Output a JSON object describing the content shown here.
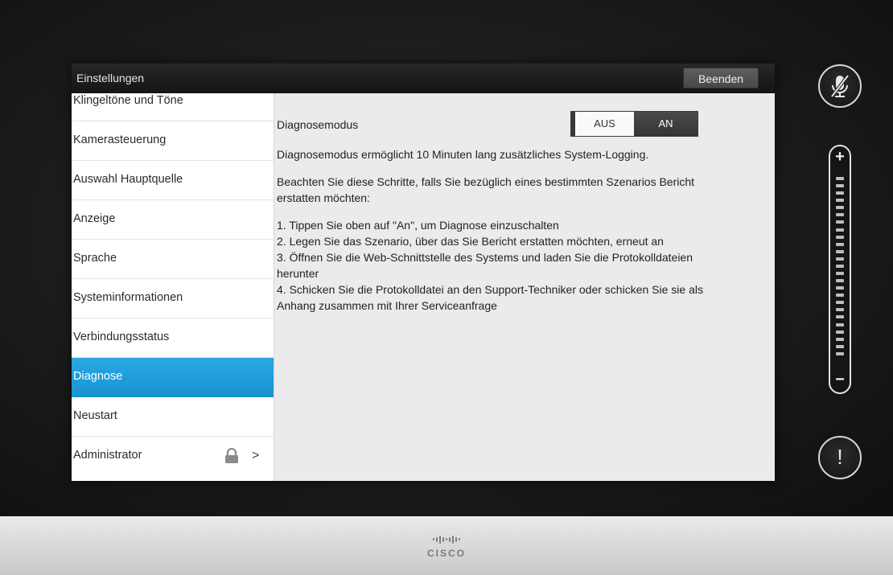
{
  "window": {
    "title": "Einstellungen",
    "end_label": "Beenden"
  },
  "sidebar": {
    "items": [
      {
        "label": "Klingeltöne und Töne"
      },
      {
        "label": "Kamerasteuerung"
      },
      {
        "label": "Auswahl Hauptquelle"
      },
      {
        "label": "Anzeige"
      },
      {
        "label": "Sprache"
      },
      {
        "label": "Systeminformationen"
      },
      {
        "label": "Verbindungsstatus"
      },
      {
        "label": "Diagnose",
        "selected": true
      },
      {
        "label": "Neustart"
      },
      {
        "label": "Administrator",
        "locked": true,
        "icon": "lock-icon",
        "trailing_icon": "chevron-right-icon"
      }
    ]
  },
  "content": {
    "diagnose_label": "Diagnosemodus",
    "toggle": {
      "off_label": "AUS",
      "on_label": "AN",
      "selected": "AN"
    },
    "intro": "Diagnosemodus ermöglicht 10 Minuten lang zusätzliches System-Logging.",
    "instruction": "Beachten Sie diese Schritte, falls Sie bezüglich eines bestimmten Szenarios Bericht erstatten möchten:",
    "steps": [
      "1. Tippen Sie oben auf \"An\", um Diagnose einzuschalten",
      "2. Legen Sie das Szenario, über das Sie Bericht erstatten möchten, erneut an",
      "3. Öffnen Sie die Web-Schnittstelle des Systems und laden Sie die Protokolldateien herunter",
      "4. Schicken Sie die Protokolldatei an den Support-Techniker oder schicken Sie sie als Anhang zusammen mit Ihrer Serviceanfrage"
    ]
  },
  "controls": {
    "mute_icon": "microphone-muted-icon",
    "volume_plus": "+",
    "volume_minus": "−",
    "alert_icon": "!"
  },
  "footer": {
    "brand": "CISCO"
  },
  "colors": {
    "accent": "#1f9ddb",
    "titlebar": "#1c1d1e",
    "background": "#ebebeb"
  }
}
